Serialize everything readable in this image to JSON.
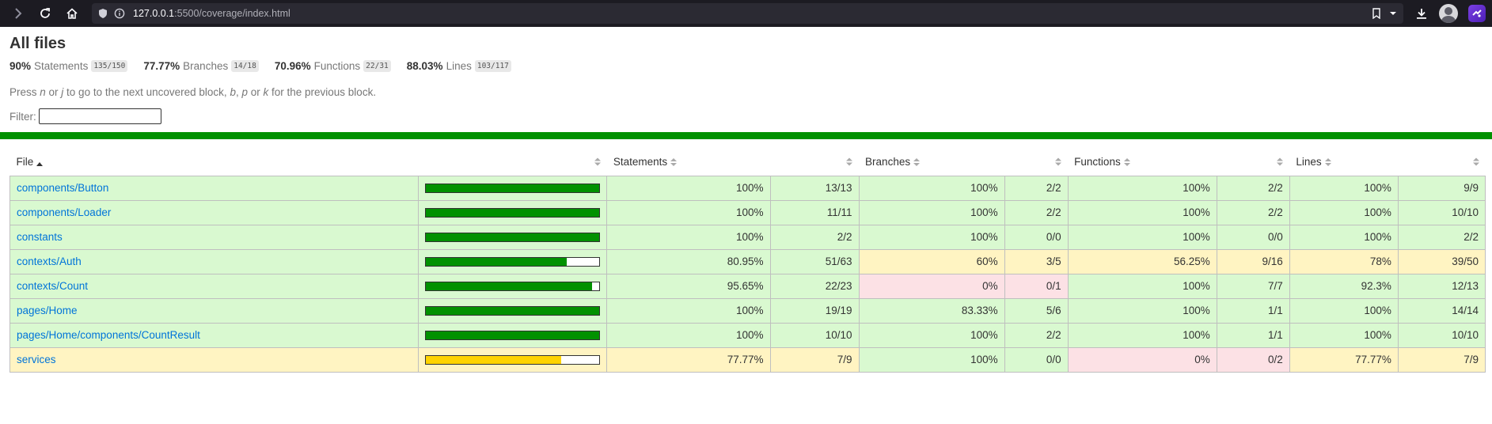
{
  "browser": {
    "url_host": "127.0.0.1",
    "url_rest": ":5500/coverage/index.html"
  },
  "page": {
    "title": "All files",
    "summary": [
      {
        "pct": "90%",
        "label": "Statements",
        "fraction": "135/150"
      },
      {
        "pct": "77.77%",
        "label": "Branches",
        "fraction": "14/18"
      },
      {
        "pct": "70.96%",
        "label": "Functions",
        "fraction": "22/31"
      },
      {
        "pct": "88.03%",
        "label": "Lines",
        "fraction": "103/117"
      }
    ],
    "hint": {
      "p1": "Press ",
      "k1": "n",
      "p2": " or ",
      "k2": "j",
      "p3": " to go to the next uncovered block, ",
      "k3": "b",
      "p4": ", ",
      "k4": "p",
      "p5": " or ",
      "k5": "k",
      "p6": " for the previous block."
    },
    "filter_label": "Filter:",
    "filter_value": ""
  },
  "table": {
    "headers": {
      "file": "File",
      "statements": "Statements",
      "branches": "Branches",
      "functions": "Functions",
      "lines": "Lines"
    },
    "rows": [
      {
        "file": "components/Button",
        "level": "high",
        "bar": 1.0,
        "stmt_pct": "100%",
        "stmt": "13/13",
        "br_pct": "100%",
        "br": "2/2",
        "fn_pct": "100%",
        "fn": "2/2",
        "ln_pct": "100%",
        "ln": "9/9",
        "cls": [
          "h",
          "h",
          "h",
          "h",
          "h",
          "h",
          "h",
          "h"
        ]
      },
      {
        "file": "components/Loader",
        "level": "high",
        "bar": 1.0,
        "stmt_pct": "100%",
        "stmt": "11/11",
        "br_pct": "100%",
        "br": "2/2",
        "fn_pct": "100%",
        "fn": "2/2",
        "ln_pct": "100%",
        "ln": "10/10",
        "cls": [
          "h",
          "h",
          "h",
          "h",
          "h",
          "h",
          "h",
          "h"
        ]
      },
      {
        "file": "constants",
        "level": "high",
        "bar": 1.0,
        "stmt_pct": "100%",
        "stmt": "2/2",
        "br_pct": "100%",
        "br": "0/0",
        "fn_pct": "100%",
        "fn": "0/0",
        "ln_pct": "100%",
        "ln": "2/2",
        "cls": [
          "h",
          "h",
          "h",
          "h",
          "h",
          "h",
          "h",
          "h"
        ]
      },
      {
        "file": "contexts/Auth",
        "level": "high",
        "bar": 0.8095,
        "stmt_pct": "80.95%",
        "stmt": "51/63",
        "br_pct": "60%",
        "br": "3/5",
        "fn_pct": "56.25%",
        "fn": "9/16",
        "ln_pct": "78%",
        "ln": "39/50",
        "cls": [
          "h",
          "h",
          "m",
          "m",
          "m",
          "m",
          "m",
          "m"
        ]
      },
      {
        "file": "contexts/Count",
        "level": "high",
        "bar": 0.9565,
        "stmt_pct": "95.65%",
        "stmt": "22/23",
        "br_pct": "0%",
        "br": "0/1",
        "fn_pct": "100%",
        "fn": "7/7",
        "ln_pct": "92.3%",
        "ln": "12/13",
        "cls": [
          "h",
          "h",
          "l",
          "l",
          "h",
          "h",
          "h",
          "h"
        ]
      },
      {
        "file": "pages/Home",
        "level": "high",
        "bar": 1.0,
        "stmt_pct": "100%",
        "stmt": "19/19",
        "br_pct": "83.33%",
        "br": "5/6",
        "fn_pct": "100%",
        "fn": "1/1",
        "ln_pct": "100%",
        "ln": "14/14",
        "cls": [
          "h",
          "h",
          "h",
          "h",
          "h",
          "h",
          "h",
          "h"
        ]
      },
      {
        "file": "pages/Home/components/CountResult",
        "level": "high",
        "bar": 1.0,
        "stmt_pct": "100%",
        "stmt": "10/10",
        "br_pct": "100%",
        "br": "2/2",
        "fn_pct": "100%",
        "fn": "1/1",
        "ln_pct": "100%",
        "ln": "10/10",
        "cls": [
          "h",
          "h",
          "h",
          "h",
          "h",
          "h",
          "h",
          "h"
        ]
      },
      {
        "file": "services",
        "level": "medium",
        "bar": 0.7777,
        "stmt_pct": "77.77%",
        "stmt": "7/9",
        "br_pct": "100%",
        "br": "0/0",
        "fn_pct": "0%",
        "fn": "0/2",
        "ln_pct": "77.77%",
        "ln": "7/9",
        "cls": [
          "m",
          "m",
          "h",
          "h",
          "l",
          "l",
          "m",
          "m"
        ]
      }
    ]
  },
  "colors": {
    "high": "#d9f9d0",
    "medium": "#fff4c2",
    "low": "#fce1e5",
    "bar_high": "#019100",
    "bar_medium": "#ffd300",
    "link": "#0074d9"
  }
}
